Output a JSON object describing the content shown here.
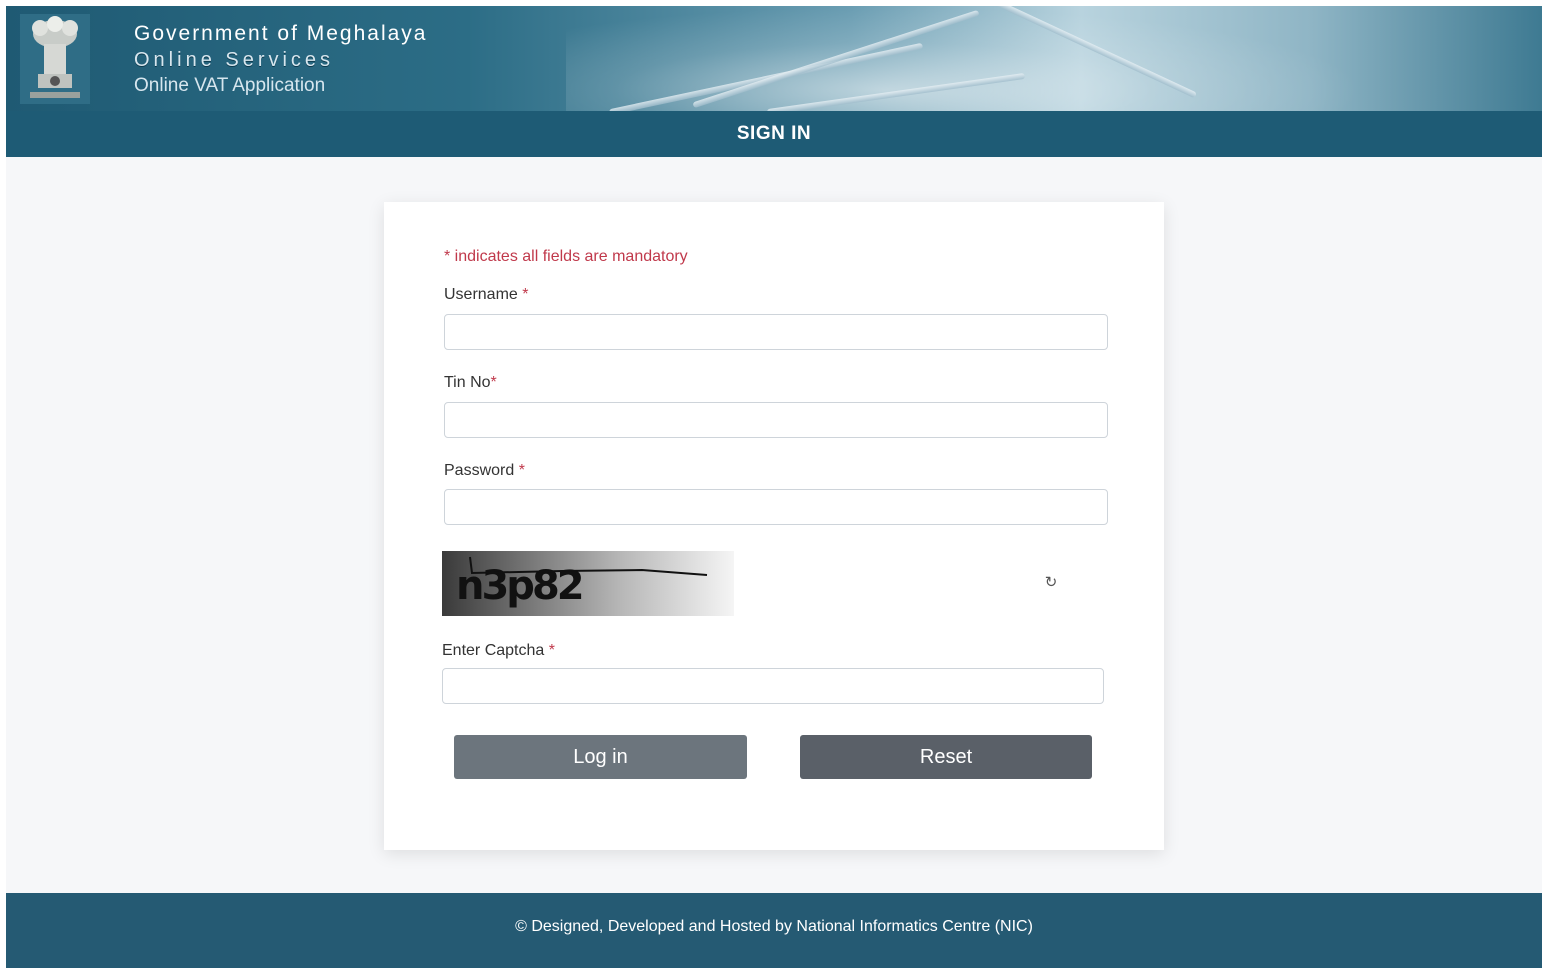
{
  "header": {
    "title_line1": "Government of Meghalaya",
    "title_line2": "Online Services",
    "title_line3": "Online VAT Application",
    "emblem_icon": "state-emblem-icon"
  },
  "signin_bar": {
    "title": "SIGN IN"
  },
  "form": {
    "mandatory_note": "* indicates all fields are mandatory",
    "username_label": "Username",
    "username_value": "",
    "tin_label": "Tin No",
    "tin_value": "",
    "password_label": "Password",
    "password_value": "",
    "captcha_text": "n3p82",
    "refresh_icon": "refresh-icon",
    "captcha_label": "Enter Captcha",
    "captcha_value": "",
    "required_mark": "*",
    "login_label": "Log in",
    "reset_label": "Reset"
  },
  "footer": {
    "text": "© Designed, Developed and Hosted by National Informatics Centre (NIC)"
  },
  "colors": {
    "header_bar": "#1e5b75",
    "footer_bar": "#255a73",
    "required": "#c0394b",
    "login_button": "#6c757d",
    "reset_button": "#5a6068"
  }
}
